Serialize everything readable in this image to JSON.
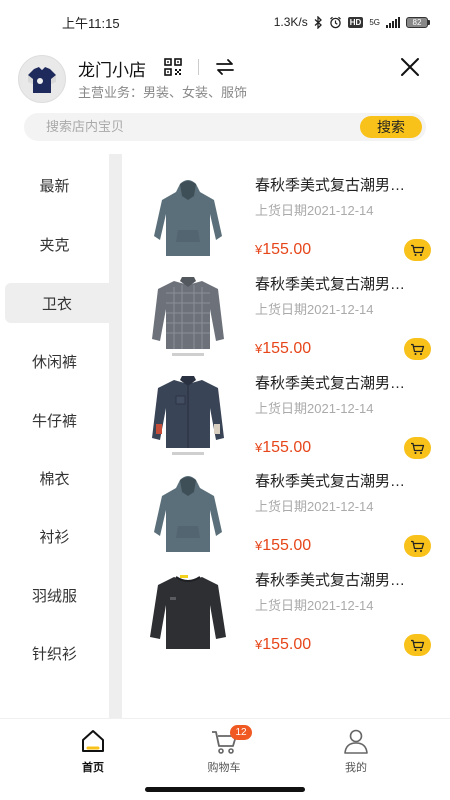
{
  "status_bar": {
    "time": "上午11:15",
    "net_speed": "1.3K/s",
    "hd": "HD",
    "network": "5G",
    "battery": "82"
  },
  "shop": {
    "name": "龙门小店",
    "business": "主营业务：男装、女装、服饰"
  },
  "search": {
    "placeholder": "搜索店内宝贝",
    "button_label": "搜索"
  },
  "categories": [
    {
      "label": "最新",
      "active": false
    },
    {
      "label": "夹克",
      "active": false
    },
    {
      "label": "卫衣",
      "active": true
    },
    {
      "label": "休闲裤",
      "active": false
    },
    {
      "label": "牛仔裤",
      "active": false
    },
    {
      "label": "棉衣",
      "active": false
    },
    {
      "label": "衬衫",
      "active": false
    },
    {
      "label": "羽绒服",
      "active": false
    },
    {
      "label": "针织衫",
      "active": false
    }
  ],
  "products": [
    {
      "title": "春秋季美式复古潮男…",
      "date": "上货日期2021-12-14",
      "currency": "¥",
      "price": "155.00",
      "image": "gray-blue-hoodie"
    },
    {
      "title": "春秋季美式复古潮男…",
      "date": "上货日期2021-12-14",
      "currency": "¥",
      "price": "155.00",
      "image": "gray-plaid-shirt"
    },
    {
      "title": "春秋季美式复古潮男…",
      "date": "上货日期2021-12-14",
      "currency": "¥",
      "price": "155.00",
      "image": "navy-shirt"
    },
    {
      "title": "春秋季美式复古潮男…",
      "date": "上货日期2021-12-14",
      "currency": "¥",
      "price": "155.00",
      "image": "gray-blue-hoodie"
    },
    {
      "title": "春秋季美式复古潮男…",
      "date": "上货日期2021-12-14",
      "currency": "¥",
      "price": "155.00",
      "image": "charcoal-sweatshirt"
    }
  ],
  "bottom_nav": {
    "home": "首页",
    "cart": "购物车",
    "cart_count": "12",
    "profile": "我的"
  },
  "colors": {
    "accent": "#f8c21a",
    "price": "#e6461a",
    "badge": "#f05a22"
  }
}
